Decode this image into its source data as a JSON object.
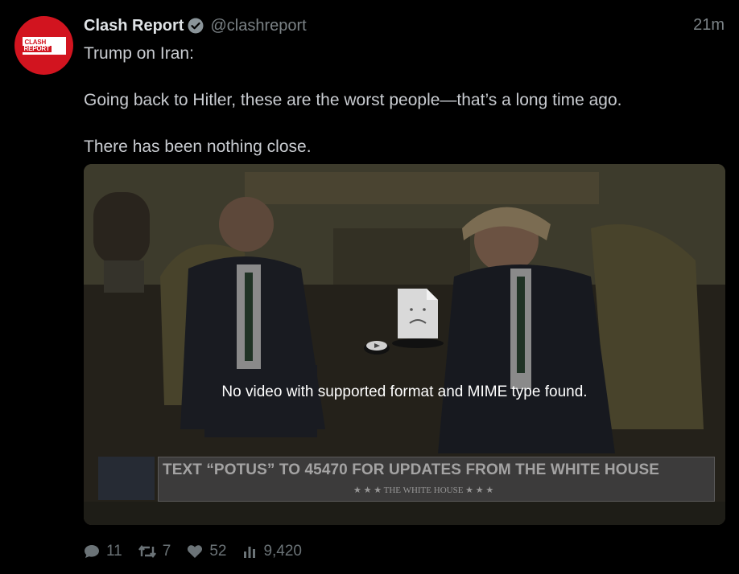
{
  "author": {
    "name": "Clash Report",
    "handle": "@clashreport",
    "avatar_text_line1": "CLASH",
    "avatar_text_line2": "REPORT",
    "verified": true
  },
  "timestamp": "21m",
  "post": {
    "line1": "Trump on Iran:",
    "line2": "Going back to Hitler, these are the worst people—that’s a long time ago.",
    "line3": "There has been nothing close."
  },
  "media": {
    "error_message": "No video with supported format and MIME type found.",
    "banner_text": "TEXT “POTUS” TO 45470 FOR UPDATES FROM THE WHITE HOUSE",
    "banner_subtext": "★ ★ ★   THE WHITE HOUSE   ★ ★ ★"
  },
  "stats": {
    "replies": "11",
    "reposts": "7",
    "likes": "52",
    "views": "9,420"
  },
  "colors": {
    "background": "#000000",
    "avatar": "#d2141f",
    "verified": "#8a9499",
    "muted": "#6b7377"
  },
  "icons": [
    "verified-icon",
    "reply-icon",
    "repost-icon",
    "like-icon",
    "views-icon",
    "broken-file-icon",
    "play-icon"
  ]
}
